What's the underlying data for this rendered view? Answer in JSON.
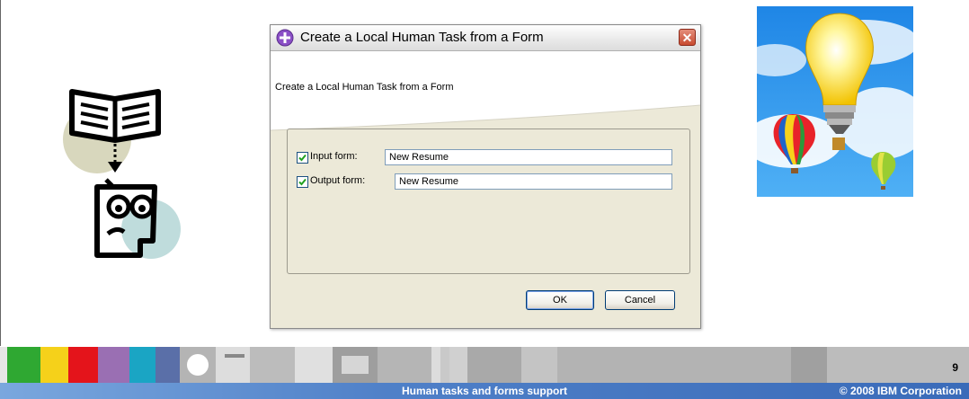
{
  "dialog": {
    "title": "Create a Local Human Task from a Form",
    "close_glyph": "✕",
    "header_text": "Create a Local Human Task from a Form",
    "input_form": {
      "label": "Input form:",
      "value": "New Resume",
      "checked": true
    },
    "output_form": {
      "label": "Output form:",
      "value": "New Resume",
      "checked": true
    },
    "ok_label": "OK",
    "cancel_label": "Cancel"
  },
  "slide": {
    "page_number": "9",
    "footer_title": "Human tasks and forms support",
    "copyright": "© 2008 IBM Corporation"
  },
  "icons": {
    "dialog_icon": "wizard-plus-icon",
    "left_clipart": "book-to-reader-icon",
    "right_clipart": "lightbulb-balloons-icon"
  },
  "colors": {
    "footer_blue": "#4f80c8",
    "strip_green": "#2fa832",
    "strip_yellow": "#f5d11a",
    "strip_red": "#e4141b",
    "strip_purple": "#9a6fb3",
    "strip_teal": "#1aa5c4"
  }
}
